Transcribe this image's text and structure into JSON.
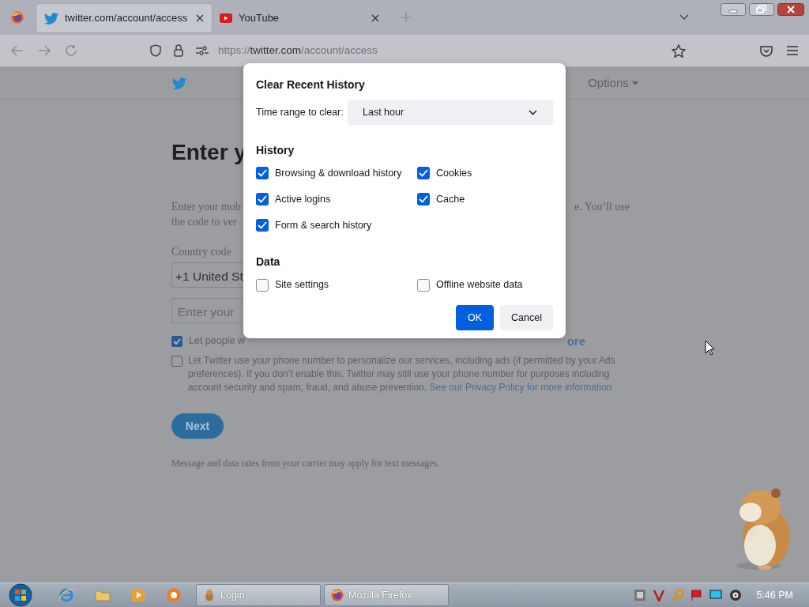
{
  "browser": {
    "tabs": [
      {
        "title": "twitter.com/account/access",
        "selected": true
      },
      {
        "title": "YouTube",
        "selected": false
      }
    ],
    "url": {
      "scheme": "https://",
      "host": "twitter.com",
      "path": "/account/access"
    }
  },
  "page": {
    "options_menu": "Options",
    "heading": "Enter y",
    "intro_lines": [
      {
        "left": "Enter your mob",
        "right": "e. You’ll use"
      },
      {
        "left": "the code to ver"
      }
    ],
    "country_label": "Country code",
    "country_value": "+1 United St",
    "phone_placeholder": "Enter your",
    "contact_option": {
      "label": "Let people w",
      "link": "ore",
      "checked": true
    },
    "personalize_option": {
      "text": "Let Twitter use your phone number to personalize our services, including ads (if permitted by your Ads preferences). If you don’t enable this, Twitter may still use your phone number for purposes including account security and spam, fraud, and abuse prevention.",
      "link": "See our Privacy Policy for more information",
      "checked": false
    },
    "next_button": "Next",
    "footnote": "Message and data rates from your carrier may apply for text messages."
  },
  "dialog": {
    "title": "Clear Recent History",
    "time_range_label": "Time range to clear:",
    "time_range_value": "Last hour",
    "sections": [
      {
        "heading": "History",
        "items": [
          {
            "label": "Browsing & download history",
            "checked": true
          },
          {
            "label": "Cookies",
            "checked": true
          },
          {
            "label": "Active logins",
            "checked": true
          },
          {
            "label": "Cache",
            "checked": true
          },
          {
            "label": "Form & search history",
            "checked": true
          }
        ]
      },
      {
        "heading": "Data",
        "items": [
          {
            "label": "Site settings",
            "checked": false
          },
          {
            "label": "Offline website data",
            "checked": false
          }
        ]
      }
    ],
    "buttons": [
      {
        "label": "OK",
        "kind": "primary"
      },
      {
        "label": "Cancel",
        "kind": "secondary"
      }
    ]
  },
  "taskbar": {
    "tasks": [
      {
        "label": "Login"
      },
      {
        "label": "Mozilla Firefox"
      }
    ],
    "clock": "5:46 PM"
  }
}
